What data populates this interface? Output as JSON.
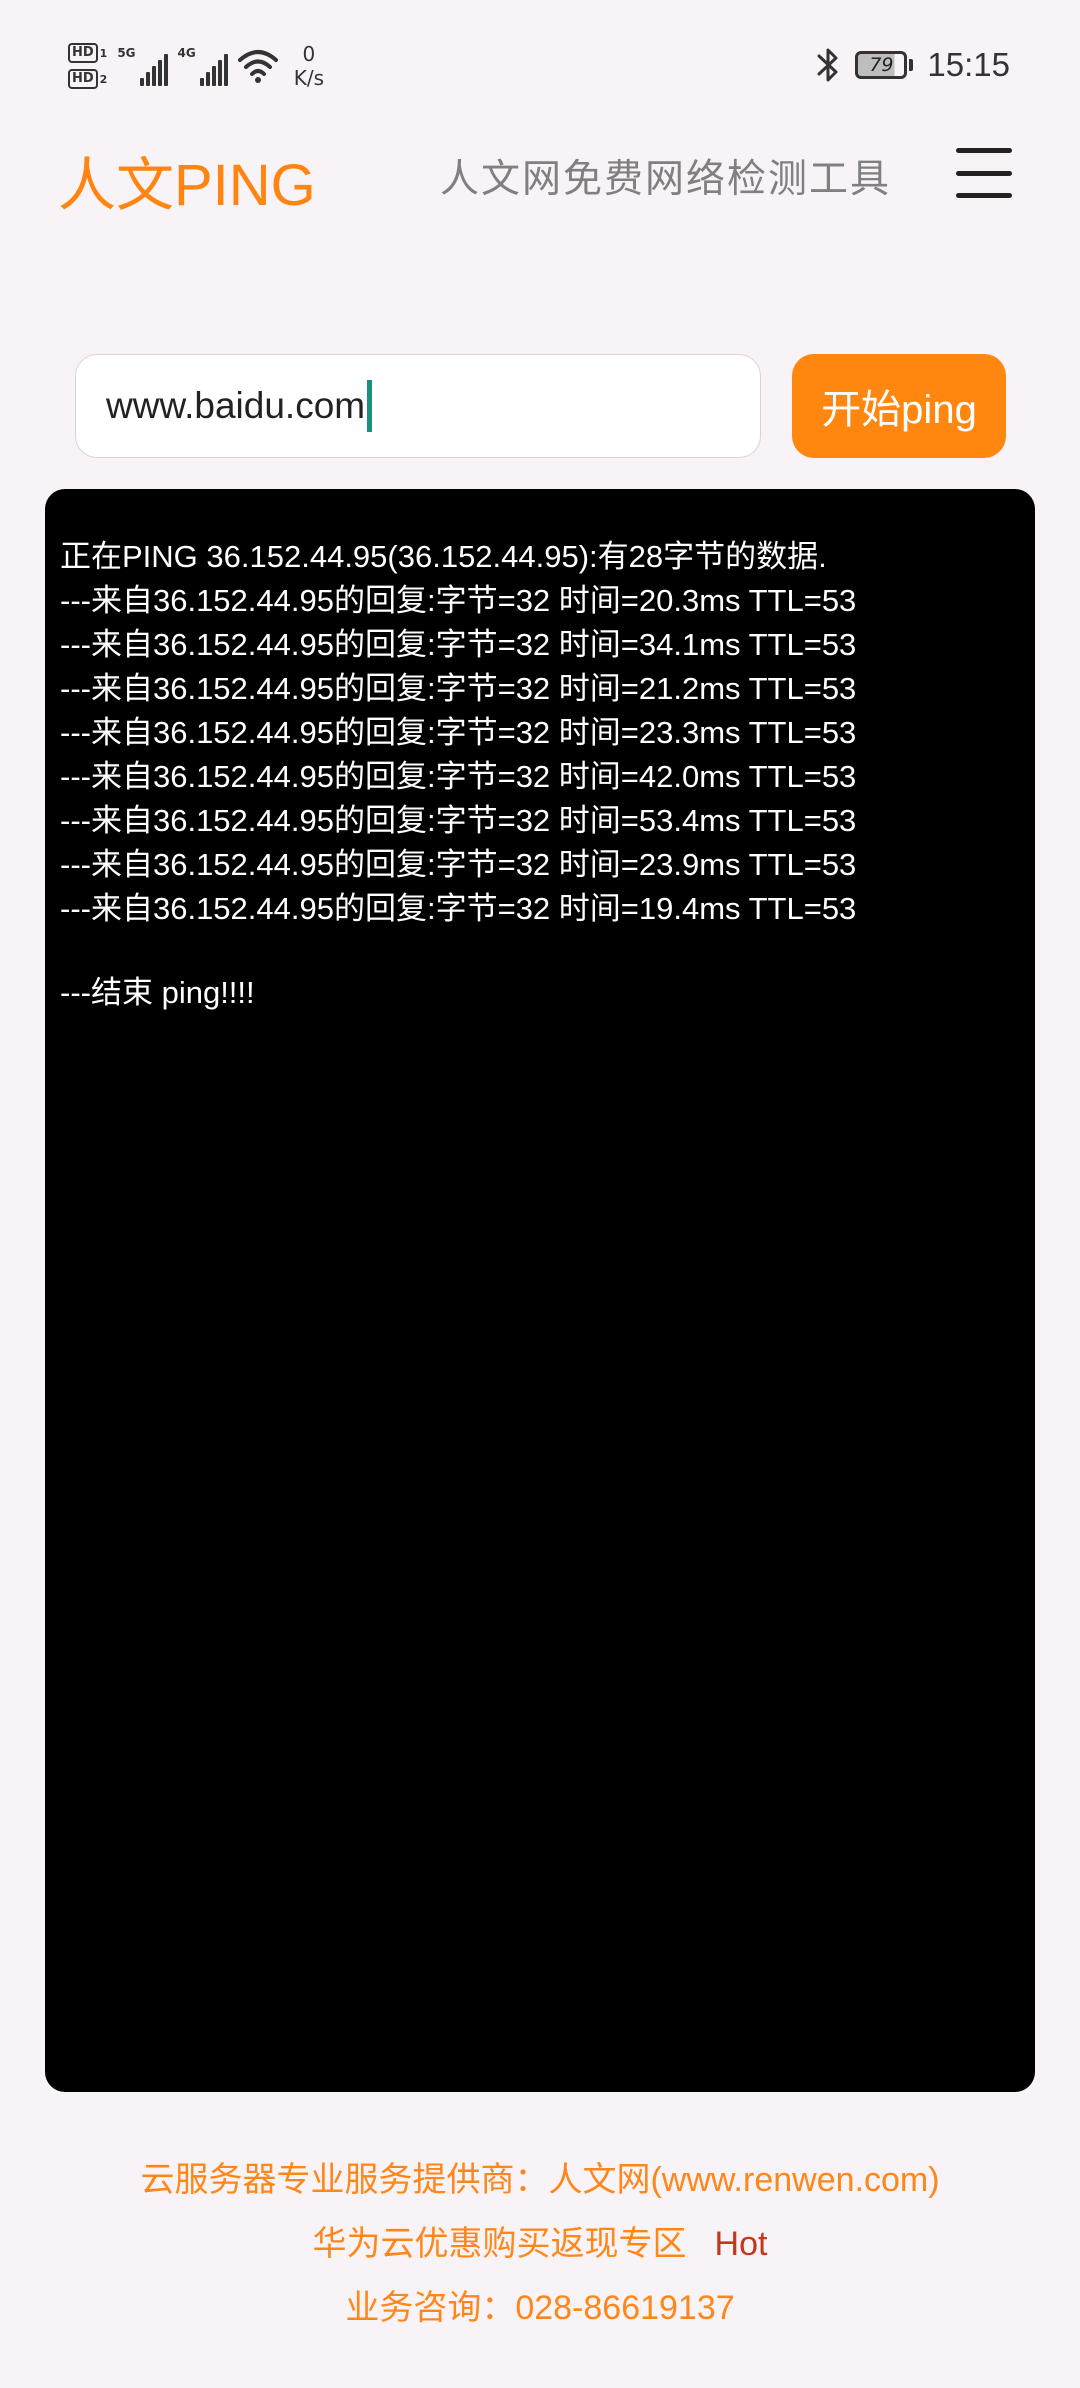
{
  "status_bar": {
    "sim1": "HD",
    "sim1_num": "1",
    "sim2": "HD",
    "sim2_num": "2",
    "net1": "5G",
    "net2": "4G",
    "speed_value": "0",
    "speed_unit": "K/s",
    "battery": "79",
    "time": "15:15"
  },
  "header": {
    "title": "人文PING",
    "subtitle": "人文网免费网络检测工具"
  },
  "form": {
    "host_value": "www.baidu.com",
    "start_label": "开始ping"
  },
  "console": {
    "lines": [
      "正在PING 36.152.44.95(36.152.44.95):有28字节的数据.",
      "---来自36.152.44.95的回复:字节=32 时间=20.3ms TTL=53",
      "---来自36.152.44.95的回复:字节=32 时间=34.1ms TTL=53",
      "---来自36.152.44.95的回复:字节=32 时间=21.2ms TTL=53",
      "---来自36.152.44.95的回复:字节=32 时间=23.3ms TTL=53",
      "---来自36.152.44.95的回复:字节=32 时间=42.0ms TTL=53",
      "---来自36.152.44.95的回复:字节=32 时间=53.4ms TTL=53",
      "---来自36.152.44.95的回复:字节=32 时间=23.9ms TTL=53",
      "---来自36.152.44.95的回复:字节=32 时间=19.4ms TTL=53"
    ],
    "end_line": "---结束 ping!!!!"
  },
  "footer": {
    "provider": "云服务器专业服务提供商：人文网(www.renwen.com)",
    "promo": "华为云优惠购买返现专区",
    "hot": "Hot",
    "contact": "业务咨询：028-86619137"
  },
  "colors": {
    "accent": "#ff870f",
    "background": "#f8f3f7",
    "console_bg": "#000000",
    "hot": "#c4371d"
  }
}
